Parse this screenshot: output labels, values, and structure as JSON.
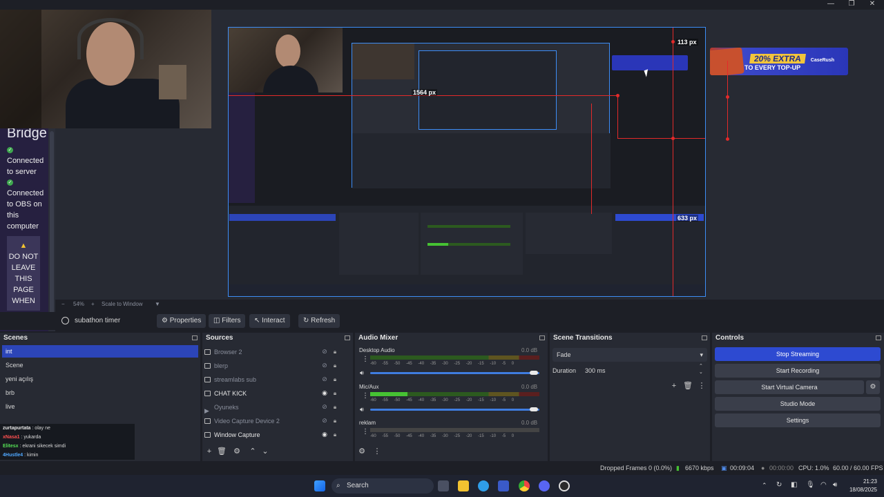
{
  "preview": {
    "bridge": {
      "title": "Bridge",
      "status1": "Connected to server",
      "status2": "Connected to OBS on this computer",
      "warning": "DO NOT LEAVE THIS PAGE WHEN"
    },
    "measures": {
      "top": "113 px",
      "side": "633 px",
      "mid": "1564 px"
    },
    "banner": {
      "line1": "20% EXTRA",
      "line2": "TO EVERY TOP-UP",
      "logo": "CaseRush"
    },
    "zoom": "54%",
    "scale_mode": "Scale to Window"
  },
  "toolbar": {
    "source_name": "subathon timer",
    "properties": "Properties",
    "filters": "Filters",
    "interact": "Interact",
    "refresh": "Refresh"
  },
  "scenes": {
    "title": "Scenes",
    "items": [
      "int",
      "Scene",
      "yeni açılış",
      "brb",
      "live"
    ],
    "active_index": 0
  },
  "chat": [
    {
      "user": "zurtapurtata",
      "msg": "olay ne"
    },
    {
      "user": "xNasa1",
      "msg": "yukarda"
    },
    {
      "user": "Elitesx",
      "msg": "ekrani sikecek simdi"
    },
    {
      "user": "4Hustle4",
      "msg": "kimin"
    }
  ],
  "sources": {
    "title": "Sources",
    "items": [
      {
        "name": "Browser 2",
        "visible": false
      },
      {
        "name": "blerp",
        "visible": false
      },
      {
        "name": "streamlabs sub",
        "visible": false
      },
      {
        "name": "CHAT KICK",
        "visible": true
      },
      {
        "name": "Oyuneks",
        "visible": false
      },
      {
        "name": "Video Capture Device 2",
        "visible": false
      },
      {
        "name": "Window Capture",
        "visible": true
      }
    ]
  },
  "audio": {
    "title": "Audio Mixer",
    "ticks": "-60 -55 -50 -45 -40 -35 -30 -25 -20 -15 -10 -5 0",
    "channels": [
      {
        "name": "Desktop Audio",
        "db": "0.0 dB",
        "level": 0.0
      },
      {
        "name": "Mic/Aux",
        "db": "0.0 dB",
        "level": 0.22
      },
      {
        "name": "reklam",
        "db": "0.0 dB",
        "level": 0.0
      }
    ]
  },
  "transitions": {
    "title": "Scene Transitions",
    "selected": "Fade",
    "duration_label": "Duration",
    "duration_value": "300 ms"
  },
  "controls": {
    "title": "Controls",
    "stop_streaming": "Stop Streaming",
    "start_recording": "Start Recording",
    "start_virtual_camera": "Start Virtual Camera",
    "studio_mode": "Studio Mode",
    "settings": "Settings"
  },
  "statusbar": {
    "dropped": "Dropped Frames 0 (0.0%)",
    "bitrate": "6670 kbps",
    "stream_time": "00:09:04",
    "rec_time": "00:00:00",
    "cpu": "CPU: 1.0%",
    "fps": "60.00 / 60.00 FPS"
  },
  "taskbar": {
    "search": "Search",
    "time": "21:23",
    "date": "18/08/2025"
  },
  "colors": {
    "accent": "#2c45b8",
    "streaming": "#2d4ad1",
    "measure": "#e42a2a",
    "selection": "#3d8ef8"
  }
}
